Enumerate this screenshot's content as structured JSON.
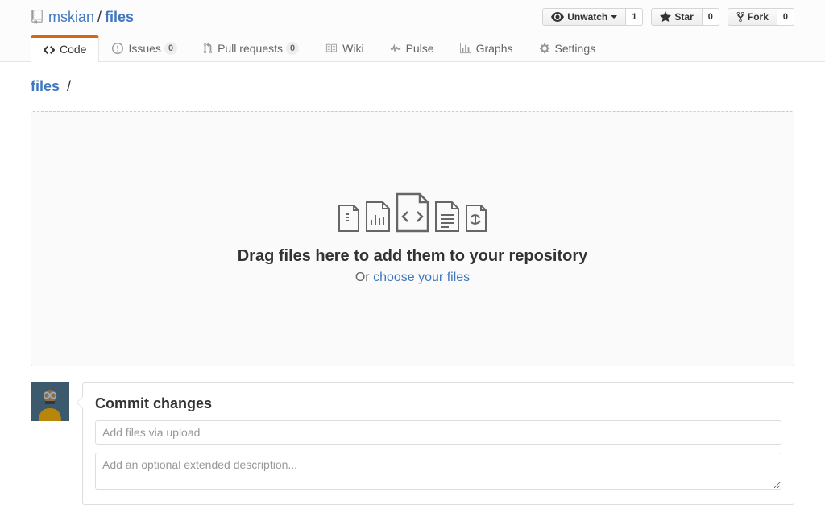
{
  "repo": {
    "owner": "mskian",
    "name": "files"
  },
  "actions": {
    "unwatch": {
      "label": "Unwatch",
      "count": "1"
    },
    "star": {
      "label": "Star",
      "count": "0"
    },
    "fork": {
      "label": "Fork",
      "count": "0"
    }
  },
  "tabs": {
    "code": "Code",
    "issues": {
      "label": "Issues",
      "count": "0"
    },
    "pulls": {
      "label": "Pull requests",
      "count": "0"
    },
    "wiki": "Wiki",
    "pulse": "Pulse",
    "graphs": "Graphs",
    "settings": "Settings"
  },
  "breadcrumb": {
    "root": "files",
    "sep": "/"
  },
  "upload": {
    "heading": "Drag files here to add them to your repository",
    "or": "Or ",
    "choose": "choose your files"
  },
  "commit": {
    "heading": "Commit changes",
    "summary_placeholder": "Add files via upload",
    "description_placeholder": "Add an optional extended description..."
  }
}
